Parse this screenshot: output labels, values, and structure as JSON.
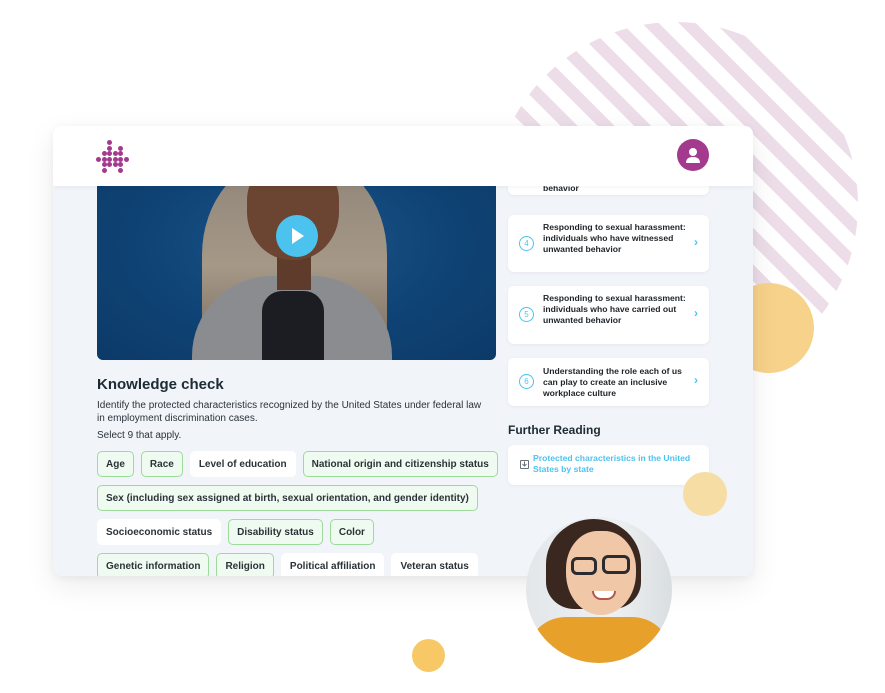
{
  "header": {
    "logo_icon": "dotted-arrow-logo",
    "avatar_icon": "user-icon",
    "brand_color": "#a33a8e"
  },
  "video": {
    "play_icon": "play-icon",
    "accent_color": "#4cc3ee"
  },
  "knowledge_check": {
    "title": "Knowledge check",
    "question": "Identify the protected characteristics recognized by the United States under federal law in employment discrimination cases.",
    "hint": "Select 9 that apply.",
    "options": [
      {
        "label": "Age",
        "selected": true
      },
      {
        "label": "Race",
        "selected": true
      },
      {
        "label": "Level of education",
        "selected": false
      },
      {
        "label": "National origin and citizenship status",
        "selected": true
      },
      {
        "label": "Sex (including sex assigned at birth, sexual orientation, and gender identity)",
        "selected": true
      },
      {
        "label": "Socioeconomic status",
        "selected": false
      },
      {
        "label": "Disability status",
        "selected": true
      },
      {
        "label": "Color",
        "selected": true
      },
      {
        "label": "Genetic information",
        "selected": true
      },
      {
        "label": "Religion",
        "selected": true
      },
      {
        "label": "Political affiliation",
        "selected": false
      },
      {
        "label": "Veteran status",
        "selected": false
      }
    ]
  },
  "lessons": [
    {
      "number": "",
      "title": "behavior"
    },
    {
      "number": "4",
      "title": "Responding to sexual harassment: individuals who have witnessed unwanted behavior"
    },
    {
      "number": "5",
      "title": "Responding to sexual harassment: individuals who have carried out unwanted behavior"
    },
    {
      "number": "6",
      "title": "Understanding the role each of us can play to create an inclusive workplace culture"
    }
  ],
  "further_reading": {
    "title": "Further Reading",
    "items": [
      {
        "icon": "download-icon",
        "label": "Protected characteristics in the United States by state"
      }
    ]
  }
}
